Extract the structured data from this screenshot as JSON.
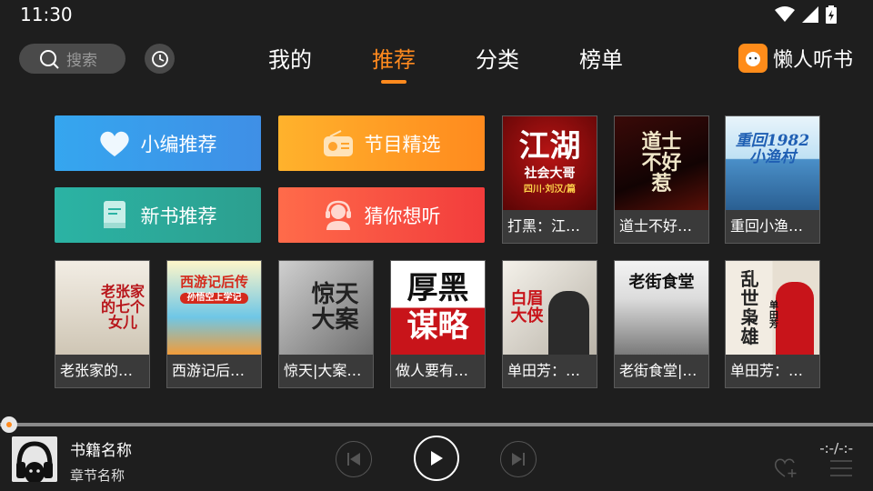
{
  "status_bar": {
    "time": "11:30",
    "icons": [
      "wifi-icon",
      "signal-icon",
      "battery-icon"
    ]
  },
  "header": {
    "search_placeholder": "搜索",
    "tabs": [
      {
        "label": "我的",
        "active": false
      },
      {
        "label": "推荐",
        "active": true
      },
      {
        "label": "分类",
        "active": false
      },
      {
        "label": "榜单",
        "active": false
      }
    ],
    "brand": "懒人听书"
  },
  "categories": [
    {
      "label": "小编推荐",
      "icon": "heart-icon",
      "color_from": "#35a6ef",
      "color_to": "#3f8fe6"
    },
    {
      "label": "节目精选",
      "icon": "radio-icon",
      "color_from": "#ffb22c",
      "color_to": "#ff8a1e"
    },
    {
      "label": "新书推荐",
      "icon": "book-icon",
      "color_from": "#2bb3a4",
      "color_to": "#2c9f8f"
    },
    {
      "label": "猜你想听",
      "icon": "headset-user-icon",
      "color_from": "#ff6b4a",
      "color_to": "#f23c3c"
    }
  ],
  "books_row1": [
    {
      "title": "打黑：江…",
      "cover_text": "江湖",
      "cover_sub": "社会大哥",
      "cover_author": "四川·刘汉/篇"
    },
    {
      "title": "道士不好…",
      "cover_text": "道士不好惹"
    },
    {
      "title": "重回小渔…",
      "cover_text": "重回1982小渔村"
    }
  ],
  "books_row2": [
    {
      "title": "老张家的…",
      "cover_text": "老张家的七个女儿"
    },
    {
      "title": "西游记后…",
      "cover_text": "西游记后传",
      "cover_sub": "孙悟空上学记"
    },
    {
      "title": "惊天|大案…",
      "cover_text": "惊天大案"
    },
    {
      "title": "做人要有…",
      "cover_text": "厚黑",
      "cover_sub": "谋略"
    },
    {
      "title": "单田芳：…",
      "cover_text": "白眉大侠"
    },
    {
      "title": "老街食堂|…",
      "cover_text": "老街食堂"
    },
    {
      "title": "单田芳：…",
      "cover_text": "乱世枭雄",
      "cover_sub": "单田芳"
    }
  ],
  "player": {
    "book_name": "书籍名称",
    "chapter_name": "章节名称",
    "time": "-:-/-:-",
    "progress": 0
  }
}
